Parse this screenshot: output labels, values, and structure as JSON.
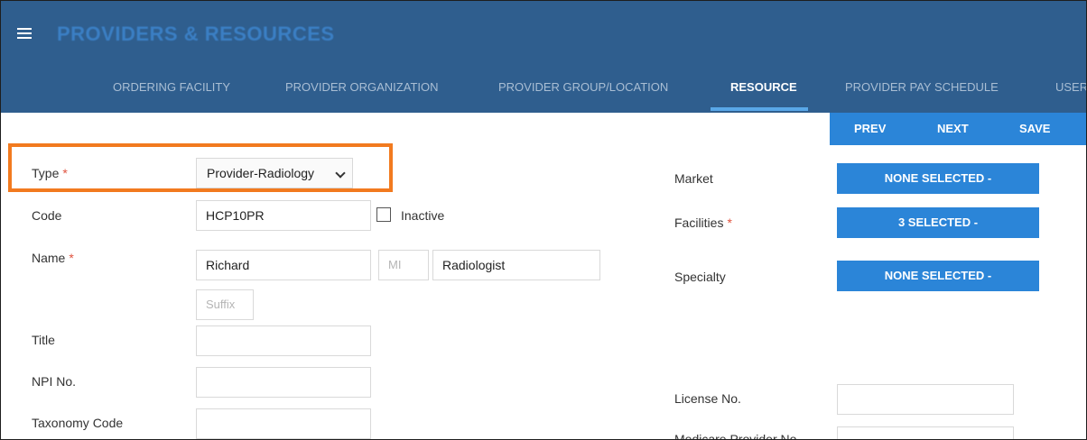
{
  "header": {
    "title": "PROVIDERS & RESOURCES",
    "menu_icon": "hamburger-menu-icon",
    "background": "#2f5e8e"
  },
  "tabs": [
    {
      "label": "ORDERING FACILITY",
      "active": false
    },
    {
      "label": "PROVIDER ORGANIZATION",
      "active": false
    },
    {
      "label": "PROVIDER GROUP/LOCATION",
      "active": false
    },
    {
      "label": "RESOURCE",
      "active": true
    },
    {
      "label": "PROVIDER PAY SCHEDULE",
      "active": false
    },
    {
      "label": "USER",
      "active": false
    }
  ],
  "toolbar": {
    "prev_label": "PREV",
    "next_label": "NEXT",
    "save_label": "SAVE"
  },
  "form": {
    "type": {
      "label": "Type",
      "required_mark": "*",
      "value": "Provider-Radiology"
    },
    "code": {
      "label": "Code",
      "value": "HCP10PR"
    },
    "inactive": {
      "label": "Inactive",
      "checked": false
    },
    "name": {
      "label": "Name",
      "required_mark": "*",
      "first": "Richard",
      "mi_placeholder": "MI",
      "last": "Radiologist",
      "suffix_placeholder": "Suffix"
    },
    "title": {
      "label": "Title",
      "value": ""
    },
    "npi": {
      "label": "NPI No.",
      "value": ""
    },
    "taxonomy": {
      "label": "Taxonomy Code",
      "value": ""
    }
  },
  "right_form": {
    "market": {
      "label": "Market",
      "value": "NONE SELECTED -"
    },
    "facilities": {
      "label": "Facilities",
      "required_mark": "*",
      "value": "3 SELECTED -"
    },
    "specialty": {
      "label": "Specialty",
      "value": "NONE SELECTED -"
    },
    "license": {
      "label": "License No.",
      "value": ""
    },
    "medicare": {
      "label": "Medicare Provider No.",
      "value": ""
    }
  },
  "colors": {
    "accent": "#2b85d8",
    "highlight": "#f27a1f",
    "required": "#e0533f"
  }
}
